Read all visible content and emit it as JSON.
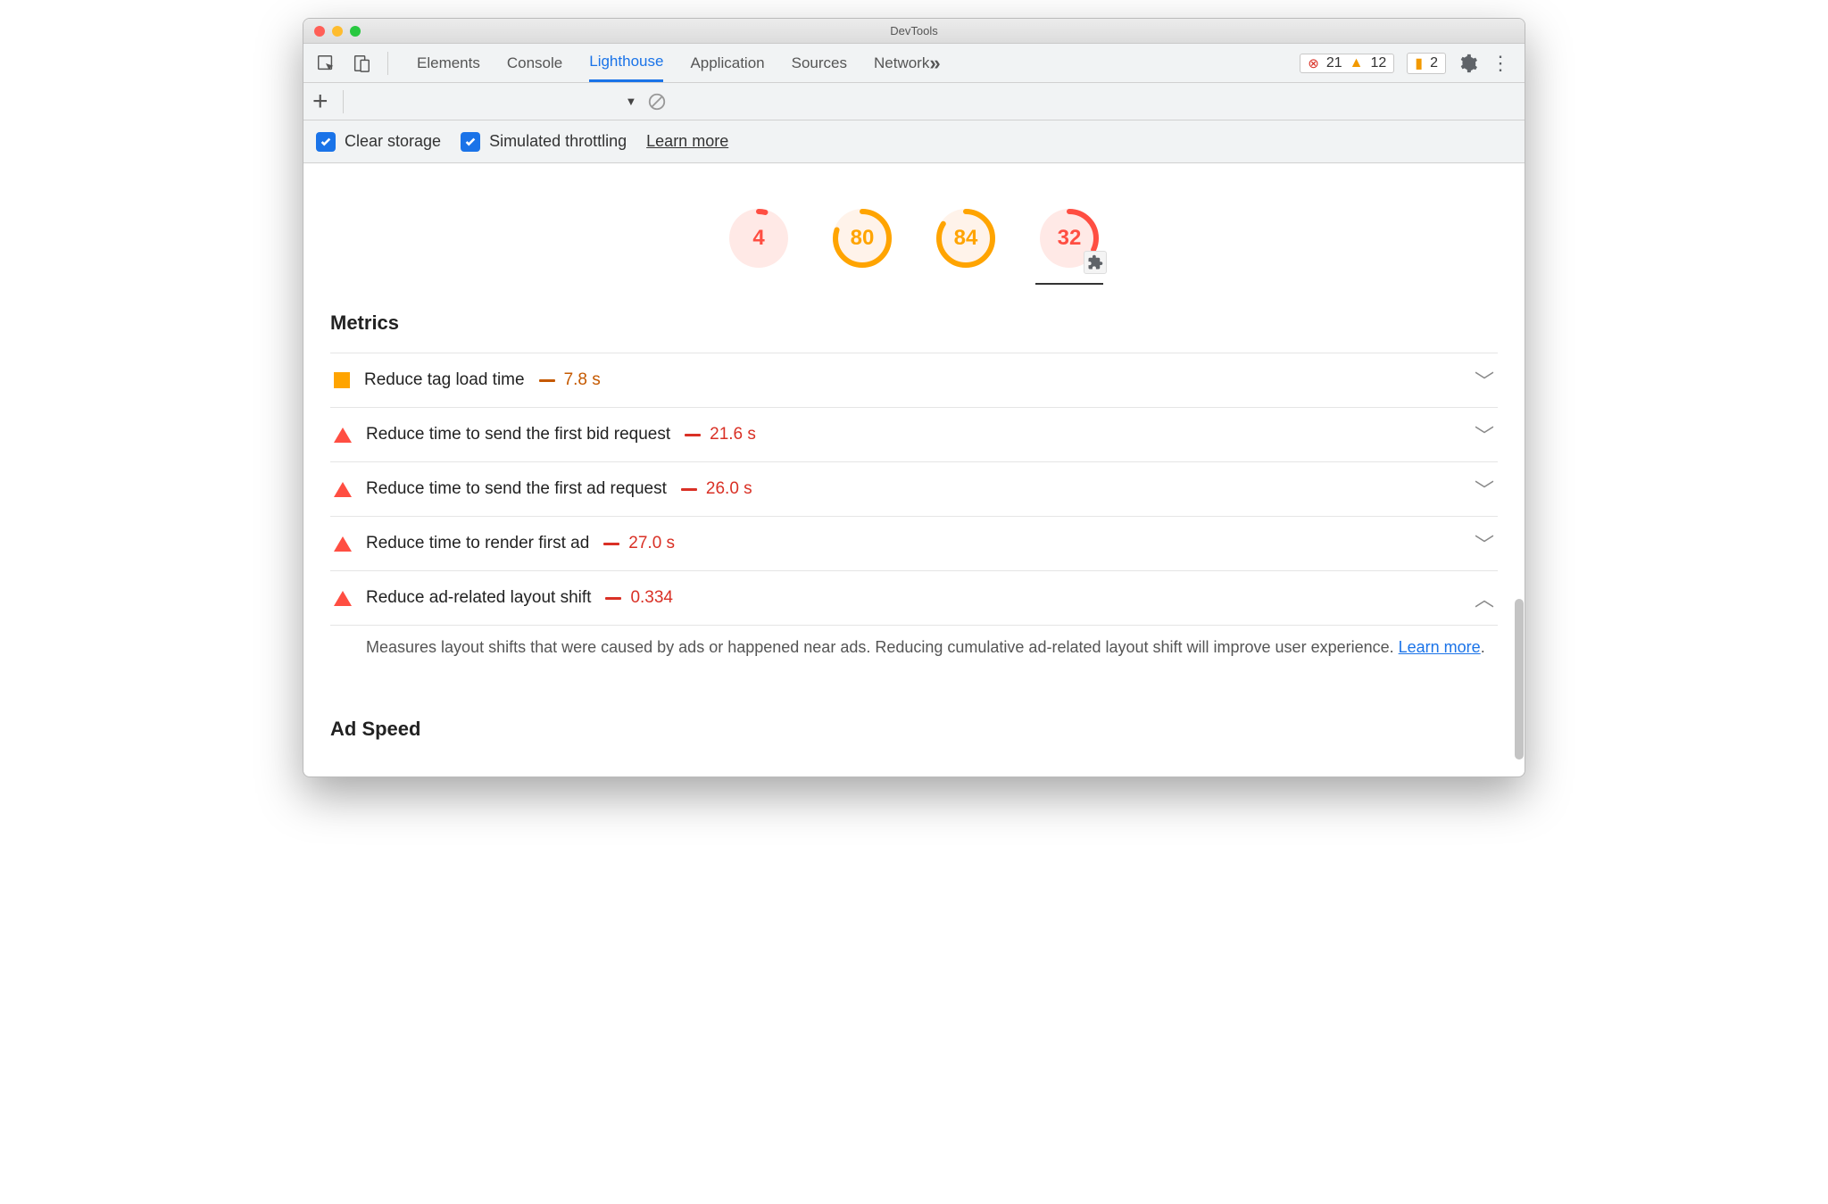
{
  "titlebar": {
    "title": "DevTools"
  },
  "tabs": {
    "items": [
      "Elements",
      "Console",
      "Lighthouse",
      "Application",
      "Sources",
      "Network"
    ],
    "activeIndex": 2
  },
  "statusbar": {
    "errors": "21",
    "warnings": "12",
    "messages": "2"
  },
  "options": {
    "clear_storage": "Clear storage",
    "simulated_throttling": "Simulated throttling",
    "learn_more": "Learn more"
  },
  "scores": [
    {
      "value": "4",
      "level": "red",
      "pct": 4
    },
    {
      "value": "80",
      "level": "orange",
      "pct": 80
    },
    {
      "value": "84",
      "level": "orange",
      "pct": 84
    },
    {
      "value": "32",
      "level": "red",
      "pct": 32,
      "selected": true,
      "plugin": true
    }
  ],
  "sections": {
    "metrics_title": "Metrics",
    "ad_speed_title": "Ad Speed"
  },
  "metrics": [
    {
      "icon": "square",
      "label": "Reduce tag load time",
      "value": "7.8 s",
      "color": "orange",
      "expanded": false
    },
    {
      "icon": "triangle",
      "label": "Reduce time to send the first bid request",
      "value": "21.6 s",
      "color": "red",
      "expanded": false
    },
    {
      "icon": "triangle",
      "label": "Reduce time to send the first ad request",
      "value": "26.0 s",
      "color": "red",
      "expanded": false
    },
    {
      "icon": "triangle",
      "label": "Reduce time to render first ad",
      "value": "27.0 s",
      "color": "red",
      "expanded": false
    },
    {
      "icon": "triangle",
      "label": "Reduce ad-related layout shift",
      "value": "0.334",
      "color": "red",
      "expanded": true,
      "description": "Measures layout shifts that were caused by ads or happened near ads. Reducing cumulative ad-related layout shift will improve user experience. ",
      "link_text": "Learn more"
    }
  ]
}
